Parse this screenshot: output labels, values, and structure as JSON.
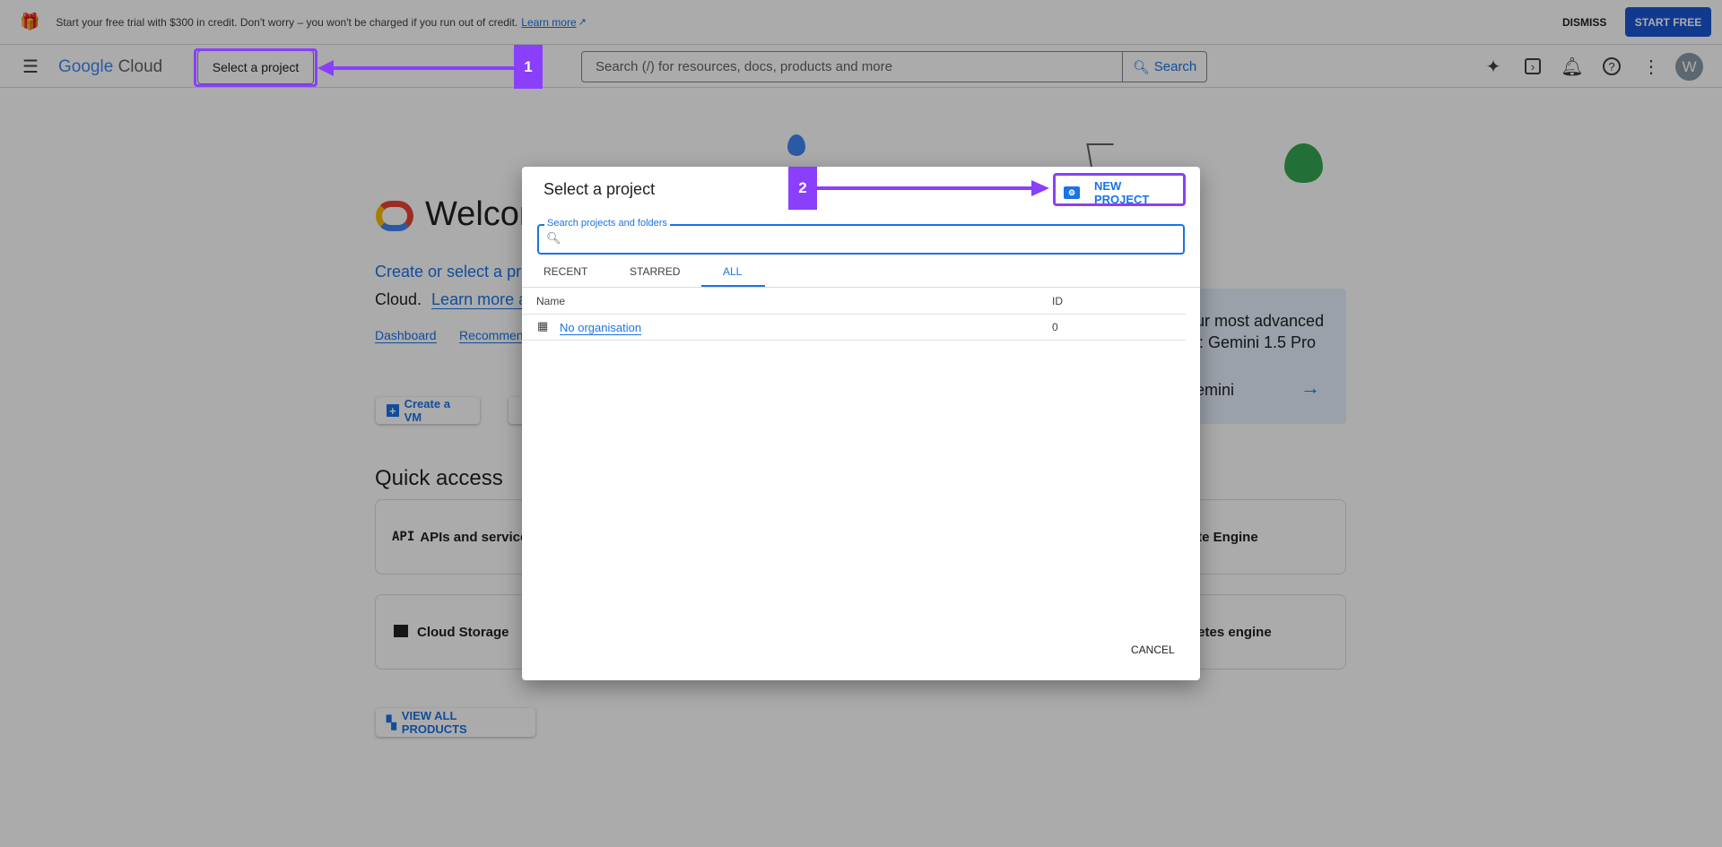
{
  "banner": {
    "text": "Start your free trial with $300 in credit. Don't worry – you won't be charged if you run out of credit.",
    "learn_more": "Learn more",
    "dismiss": "DISMISS",
    "start_free": "START FREE"
  },
  "nav": {
    "logo_google": "Google",
    "logo_cloud": "Cloud",
    "project_picker": "Select a project",
    "search_placeholder": "Search (/) for resources, docs, products and more",
    "search_button": "Search",
    "avatar_initial": "W"
  },
  "welcome": {
    "title": "Welcome",
    "subtitle": "Create or select a pr",
    "line2_prefix": "Cloud.",
    "learn_more": "Learn more a",
    "links": [
      "Dashboard",
      "Recommen"
    ],
    "create_vm": "Create a VM"
  },
  "gemini": {
    "line1": "ur most advanced",
    "line2": "l: Gemini 1.5 Pro",
    "link": "emini"
  },
  "quick_access": {
    "title": "Quick access",
    "cards": [
      "APIs and services",
      "Cloud Storage",
      "ute Engine",
      "netes engine"
    ],
    "api_glyph": "API",
    "view_all": "VIEW ALL PRODUCTS"
  },
  "dialog": {
    "title": "Select a project",
    "new_project": "NEW PROJECT",
    "search_label": "Search projects and folders",
    "search_value": "",
    "tabs": [
      "RECENT",
      "STARRED",
      "ALL"
    ],
    "active_tab": "ALL",
    "columns": [
      "Name",
      "ID"
    ],
    "rows": [
      {
        "name": "No organisation",
        "id": "0"
      }
    ],
    "cancel": "CANCEL"
  },
  "annotations": {
    "step1": "1",
    "step2": "2",
    "color": "#8a3ffc"
  },
  "colors": {
    "accent": "#1a73e8",
    "primary_button": "#1a57d6"
  }
}
